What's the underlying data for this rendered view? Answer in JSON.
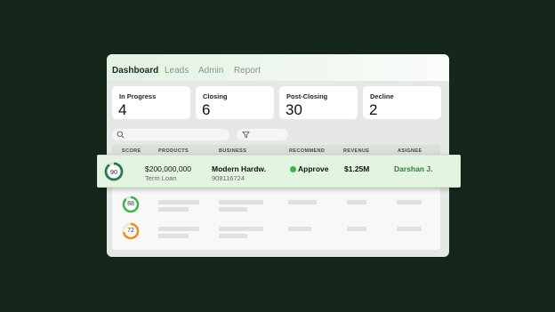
{
  "nav": {
    "tabs": [
      {
        "label": "Dashboard",
        "active": true
      },
      {
        "label": "Leads",
        "active": false
      },
      {
        "label": "Admin",
        "active": false
      },
      {
        "label": "Report",
        "active": false
      }
    ]
  },
  "stats": [
    {
      "label": "In Progress",
      "value": "4"
    },
    {
      "label": "Closing",
      "value": "6"
    },
    {
      "label": "Post-Closing",
      "value": "30"
    },
    {
      "label": "Decline",
      "value": "2"
    }
  ],
  "table": {
    "headers": [
      "SCORE",
      "PRODUCTS",
      "BUSINESS",
      "RECOMMEND",
      "REVENUE",
      "ASIGNEE"
    ],
    "highlight": {
      "score": "90",
      "amount": "$200,000,000",
      "product": "Term Loan",
      "business": "Modern Hardw.",
      "business_id": "908116724",
      "recommend": "Approve",
      "revenue": "$1.25M",
      "assignee": "Darshan J."
    },
    "rows": [
      {
        "score": "88"
      },
      {
        "score": "72"
      }
    ]
  },
  "colors": {
    "background": "#15271a",
    "accent_green": "#2e9e45",
    "score_high": "#2c7a4b",
    "score_mid": "#3ab54a",
    "score_low": "#f08a1c",
    "assignee": "#2e7d3a"
  },
  "icons": {
    "search": "search-icon",
    "filter": "filter-icon",
    "recommend": "status-dot-icon"
  }
}
